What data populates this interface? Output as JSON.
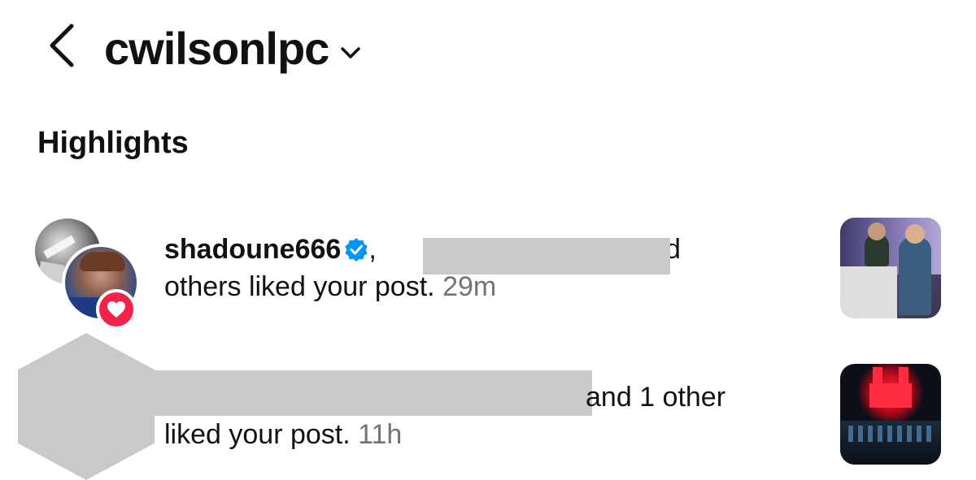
{
  "header": {
    "title": "cwilsonlpc"
  },
  "section": {
    "title": "Highlights"
  },
  "notifications": [
    {
      "username": "shadoune666",
      "comma": ",",
      "suffix": "and",
      "text": "others liked your post.",
      "time": "29m"
    },
    {
      "visible_fragment": "and 1 other",
      "text": "liked your post.",
      "time": "11h"
    }
  ],
  "colors": {
    "like_badge": "#f2224a",
    "verified": "#0095f6",
    "redaction": "#c9c9c9",
    "muted_text": "#737373"
  },
  "icons": {
    "back": "chevron-left-icon",
    "dropdown": "chevron-down-icon",
    "verified": "verified-badge-icon",
    "like": "heart-icon"
  }
}
